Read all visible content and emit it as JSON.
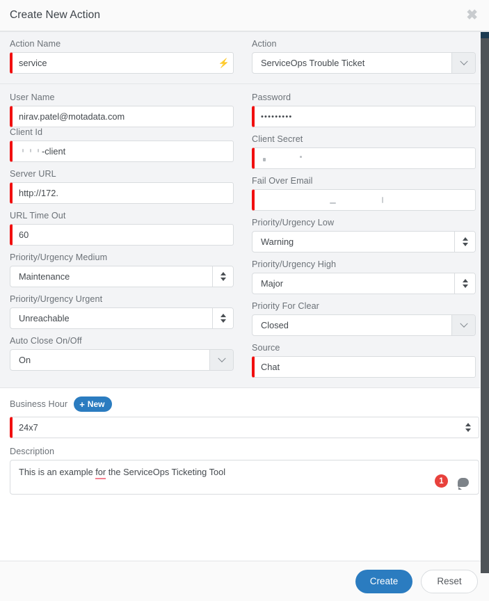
{
  "header": {
    "title": "Create New Action",
    "close_icon": "close-icon"
  },
  "form": {
    "action_name": {
      "label": "Action Name",
      "value": "service",
      "icon": "lightning-bolt-icon",
      "required": true
    },
    "action": {
      "label": "Action",
      "value": "ServiceOps Trouble Ticket",
      "control": "dropdown"
    },
    "user_name": {
      "label": "User Name",
      "value": "nirav.patel@motadata.com",
      "required": true
    },
    "password": {
      "label": "Password",
      "value": "•••••••••",
      "required": true
    },
    "client_id": {
      "label": "Client Id",
      "value": "-client",
      "required": true,
      "redacted": true
    },
    "client_secret": {
      "label": "Client Secret",
      "value": "",
      "required": true,
      "redacted": true
    },
    "server_url": {
      "label": "Server URL",
      "value": "http://172.",
      "required": true
    },
    "fail_over_email": {
      "label": "Fail Over Email",
      "value": "",
      "required": true,
      "redacted": true
    },
    "url_time_out": {
      "label": "URL Time Out",
      "value": "60",
      "required": true
    },
    "priority_low": {
      "label": "Priority/Urgency Low",
      "value": "Warning",
      "control": "spinner"
    },
    "priority_medium": {
      "label": "Priority/Urgency Medium",
      "value": "Maintenance",
      "control": "spinner"
    },
    "priority_high": {
      "label": "Priority/Urgency High",
      "value": "Major",
      "control": "spinner"
    },
    "priority_urgent": {
      "label": "Priority/Urgency Urgent",
      "value": "Unreachable",
      "control": "spinner"
    },
    "priority_for_clear": {
      "label": "Priority For Clear",
      "value": "Closed",
      "control": "dropdown"
    },
    "auto_close": {
      "label": "Auto Close On/Off",
      "value": "On",
      "control": "dropdown"
    },
    "source": {
      "label": "Source",
      "value": "Chat",
      "required": true
    },
    "business_hour": {
      "label": "Business Hour",
      "new_button": "New",
      "new_icon": "plus-icon",
      "value": "24x7",
      "control": "spinner",
      "required": true
    },
    "description": {
      "label": "Description",
      "text_before": "This is an example ",
      "text_misspelled": "for",
      "text_after": " the ServiceOps  Ticketing Tool",
      "grammar_count": "1",
      "grammar_icon": "comment-bubble-icon"
    }
  },
  "footer": {
    "create_label": "Create",
    "reset_label": "Reset"
  },
  "colors": {
    "accent": "#2b7cc0",
    "required_marker": "#f10f0f",
    "badge": "#e8413c",
    "section_grey": "#f3f4f6"
  }
}
